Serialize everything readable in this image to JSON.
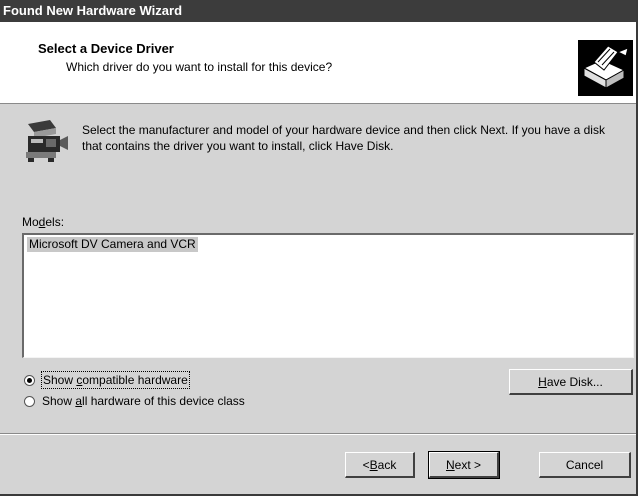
{
  "window": {
    "title": "Found New Hardware Wizard"
  },
  "header": {
    "title": "Select a Device Driver",
    "subtitle": "Which driver do you want to install for this device?",
    "icon": "hardware-wizard-icon"
  },
  "info": {
    "icon": "camera-device-icon",
    "text": "Select the manufacturer and model of your hardware device and then click Next. If you have a disk that contains the driver you want to install, click Have Disk."
  },
  "models": {
    "label_pre": "Mo",
    "label_accel": "d",
    "label_post": "els:",
    "items": [
      "Microsoft DV Camera and VCR"
    ],
    "selected_index": 0
  },
  "options": {
    "compatible": {
      "pre": "Show ",
      "accel": "c",
      "post": "ompatible hardware",
      "checked": true
    },
    "all": {
      "pre": "Show ",
      "accel": "a",
      "post": "ll hardware of this device class",
      "checked": false
    }
  },
  "buttons": {
    "have_disk": {
      "accel": "H",
      "rest": "ave Disk..."
    },
    "back": {
      "pre": "< ",
      "accel": "B",
      "rest": "ack"
    },
    "next": {
      "accel": "N",
      "rest": "ext >"
    },
    "cancel": "Cancel"
  }
}
